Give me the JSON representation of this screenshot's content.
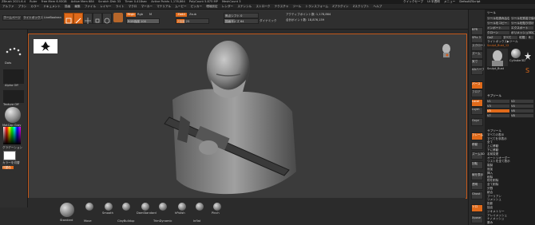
{
  "titlebar": {
    "items": [
      "ZBrush 2021.6.4",
      "Ruler",
      "Free Mem 6.93GB",
      "Active Mem 684",
      "Scratch Disk 33",
      "Timer 0.418sec",
      "Active Points 1,178,864",
      "PolyCount 5.875 MP",
      "MeshCount 3"
    ],
    "quicksave": "クイックセーブ",
    "interface": "UI 半透明",
    "menus_label": "メニュー",
    "script": "DefaultZScript"
  },
  "menubar": {
    "items": [
      "アルファ",
      "ブラシ",
      "カラー",
      "ドキュメント",
      "描画",
      "編集",
      "ファイル",
      "レイヤー",
      "ライト",
      "マクロ",
      "マーカー",
      "マテリアル",
      "ムービー",
      "ピッカー",
      "環境設定",
      "レンダー",
      "ステンシル",
      "ストローク",
      "テクスチャ",
      "ツール",
      "トランスフォーム",
      "Zプラグイン",
      "Zスクリプト",
      "ヘルプ"
    ]
  },
  "shelf": {
    "home": "ホームページ",
    "lightbox": "ライトボックス",
    "liveboolean": "LiveBoolean",
    "tools": [
      {
        "label": "編集",
        "icon": "edit-icon",
        "active": true
      },
      {
        "label": "描画",
        "icon": "draw-pencil-icon",
        "active": true
      },
      {
        "label": "移動",
        "icon": "move-icon",
        "active": false
      },
      {
        "label": "スケール",
        "icon": "scale-icon",
        "active": false
      },
      {
        "label": "回転",
        "icon": "rotate-icon",
        "active": false
      }
    ],
    "mrgb": "Mrgb",
    "rgb": "Rgb",
    "m": "M",
    "zadd": "Zadd",
    "zsub": "Zsub",
    "rgb_intensity": "RGB強度 100",
    "z_intensity": "Z強度 25",
    "focal_shift": "焦点シフト 0",
    "draw_size": "描画サイズ 64",
    "dynamic": "ダイナミック",
    "active_points": "アクティブポイント数: 1,178,864",
    "total_points": "合計ポイント数: 18,876,159"
  },
  "leftpanel": {
    "stroke": "Dots",
    "alpha": "Alpha Off",
    "texture": "Texture Off",
    "material": "MatCap Gray",
    "gradient": "グラデーション",
    "switch_color": "カラーを切替",
    "alternate": "代替色"
  },
  "rightbar": {
    "buttons": [
      "BPR",
      "SPix 3",
      "スクロール",
      "ズーム",
      "実寸",
      "AAハーフ",
      "パース",
      "フロア",
      "Local",
      "Lsym",
      "Gxyz",
      "フレーム",
      "移動",
      "ズーム3D",
      "回転",
      "線を表示",
      "透明",
      "Ghost",
      "ソロ",
      "Xpose"
    ]
  },
  "tray": {
    "header": "ツール",
    "top_buttons": [
      "ツールを読み込む",
      "ツールを別名で保存",
      "ツールをコピー",
      "ツールを貼り付け",
      "インポート",
      "エクスポート",
      "クローン",
      "ポリメッシュ3Dにする",
      "GoZ",
      "すべて",
      "可視",
      "R"
    ],
    "lightbox_tools": "ライトボックス▶ツール",
    "tool_name": "Sculpt_Bust_12",
    "thumbs": [
      "Sculpt_Bust",
      "Cylinder3D",
      "PolyMesh3D",
      "SimpleBrush"
    ],
    "subtool_header": "サブツール",
    "subtool_list": [
      "V1",
      "V2",
      "V3",
      "V4",
      "V5",
      "V6",
      "V7",
      "V8"
    ],
    "subtool_items": [
      "サブツール",
      "すべての表示",
      "すべてを非表示",
      "全て",
      "上に移動",
      "下に移動",
      "名前変更",
      "オートリオーダー",
      "リストを全て表示",
      "複製",
      "追加",
      "挿入",
      "削除",
      "他を削除",
      "全て削除",
      "分割",
      "統合",
      "ブーリアン",
      "リメッシュ",
      "投影",
      "抽出",
      "ジオメトリー",
      "アレイメッシュ",
      "ナノメッシュ",
      "厚み",
      "レイヤー",
      "ファイバーメッシュ"
    ],
    "bottom_items": [
      "ジオメトリーHD",
      "プレビュー",
      "サーフェス",
      "変形",
      "マスク",
      "可視性",
      "ポリグループ",
      "コンタクト",
      "モーフターゲット",
      "ポリペイント",
      "UVマップ",
      "テクスチャマップ",
      "ディスプレースメントマップ",
      "ノーマルマップ",
      "ベクターディスプレースメントマップ",
      "ディスプレイプロパティ",
      "統合",
      "インポート",
      "エクスポート"
    ]
  },
  "bottomshelf": {
    "brushes": [
      "Standard",
      "Move",
      "Smooth",
      "ClayBuildup",
      "DamStandard",
      "TrimDynamic",
      "hPolish",
      "Inflat",
      "Pinch"
    ]
  }
}
